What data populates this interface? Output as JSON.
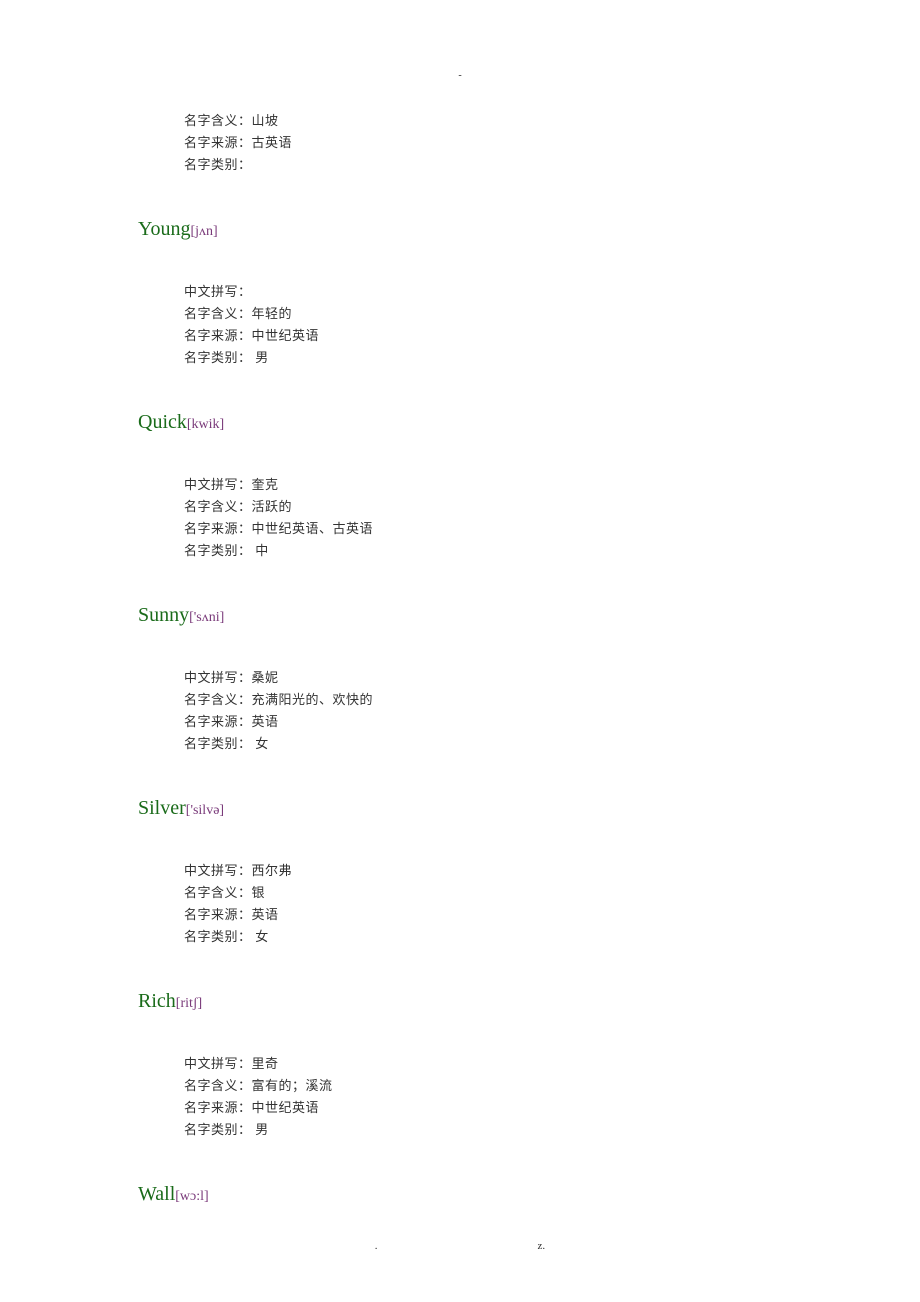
{
  "page_marker_top": "-",
  "entries": [
    {
      "name": null,
      "pronunciation": null,
      "details": {
        "pinyin": null,
        "meaning": "山坡",
        "origin": "古英语",
        "category": ""
      }
    },
    {
      "name": "Young",
      "pronunciation": "[jʌn]",
      "details": {
        "pinyin": "",
        "meaning": "年轻的",
        "origin": "中世纪英语",
        "category": "男"
      }
    },
    {
      "name": "Quick",
      "pronunciation": "[kwik]",
      "details": {
        "pinyin": "奎克",
        "meaning": "活跃的",
        "origin": "中世纪英语、古英语",
        "category": "中"
      }
    },
    {
      "name": "Sunny",
      "pronunciation": "['sʌni]",
      "details": {
        "pinyin": "桑妮",
        "meaning": "充满阳光的、欢快的",
        "origin": "英语",
        "category": "女"
      }
    },
    {
      "name": "Silver",
      "pronunciation": "['silvə]",
      "details": {
        "pinyin": "西尔弗",
        "meaning": "银",
        "origin": "英语",
        "category": "女"
      }
    },
    {
      "name": "Rich",
      "pronunciation": "[ritʃ]",
      "details": {
        "pinyin": "里奇",
        "meaning": "富有的；溪流",
        "origin": "中世纪英语",
        "category": "男"
      }
    },
    {
      "name": "Wall",
      "pronunciation": "[wɔ:l]",
      "details": null
    }
  ],
  "labels": {
    "pinyin_label": "中文拼写：",
    "meaning_label": "名字含义：",
    "origin_label": "名字来源：",
    "category_label": "名字类别："
  },
  "footer": {
    "dot": ".",
    "z": "z."
  }
}
